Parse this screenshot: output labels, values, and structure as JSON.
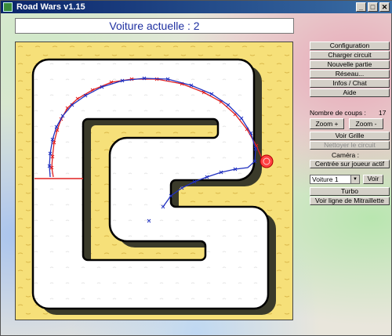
{
  "window": {
    "title": "Road Wars v1.15",
    "controls": [
      "_",
      "□",
      "✕"
    ]
  },
  "banner": {
    "current_car": "Voiture actuelle : 2"
  },
  "menu": {
    "configuration": "Configuration",
    "load_track": "Charger circuit",
    "new_game": "Nouvelle partie",
    "network": "Réseau...",
    "info_chat": "Infos / Chat",
    "help": "Aide"
  },
  "game": {
    "moves_label": "Nombre de coups :",
    "moves_value": "17",
    "zoom_in": "Zoom +",
    "zoom_out": "Zoom -",
    "show_grid": "Voir Grille",
    "clear_track": "Nettoyer le circuit",
    "camera_label": "Caméra :",
    "camera_mode": "Centrée sur joueur actif",
    "car_select": "Voiture 1",
    "view_button": "Voir",
    "turbo": "Turbo",
    "machine_gun_line": "Voir ligne de Mitraillette"
  },
  "colors": {
    "player1": "#e02020",
    "player2": "#2030c0",
    "sand": "#f6e079",
    "road": "#ffffff",
    "shadow": "#3a3a2a",
    "banner_text": "#1e2fa0"
  },
  "icons": [
    "road-wars-app-icon",
    "minimize-icon",
    "maximize-icon",
    "close-icon",
    "dropdown-arrow-icon",
    "car-marker-icon"
  ]
}
